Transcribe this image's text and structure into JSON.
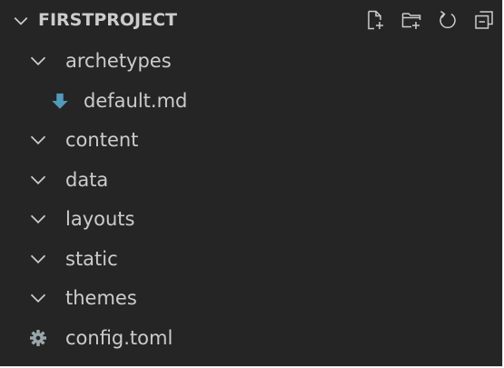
{
  "explorer": {
    "section_title": "FIRSTPROJECT",
    "section_chevron_icon": "chevron-down-icon",
    "actions": [
      {
        "name": "new-file-button",
        "icon": "new-file-icon"
      },
      {
        "name": "new-folder-button",
        "icon": "new-folder-icon"
      },
      {
        "name": "refresh-button",
        "icon": "refresh-icon"
      },
      {
        "name": "collapse-all-button",
        "icon": "collapse-all-icon"
      }
    ],
    "items": [
      {
        "label": "archetypes",
        "type": "folder",
        "expanded": true,
        "icon": "chevron-down-icon"
      },
      {
        "label": "default.md",
        "type": "file",
        "icon": "markdown-icon"
      },
      {
        "label": "content",
        "type": "folder",
        "expanded": true,
        "icon": "chevron-down-icon"
      },
      {
        "label": "data",
        "type": "folder",
        "expanded": true,
        "icon": "chevron-down-icon"
      },
      {
        "label": "layouts",
        "type": "folder",
        "expanded": true,
        "icon": "chevron-down-icon"
      },
      {
        "label": "static",
        "type": "folder",
        "expanded": true,
        "icon": "chevron-down-icon"
      },
      {
        "label": "themes",
        "type": "folder",
        "expanded": true,
        "icon": "chevron-down-icon"
      },
      {
        "label": "config.toml",
        "type": "file",
        "icon": "gear-icon"
      }
    ]
  },
  "colors": {
    "background": "#252526",
    "text": "#cccccc",
    "markdown_icon": "#519aba",
    "config_icon": "#9aa5ab",
    "frame": "#e8e8e8"
  }
}
